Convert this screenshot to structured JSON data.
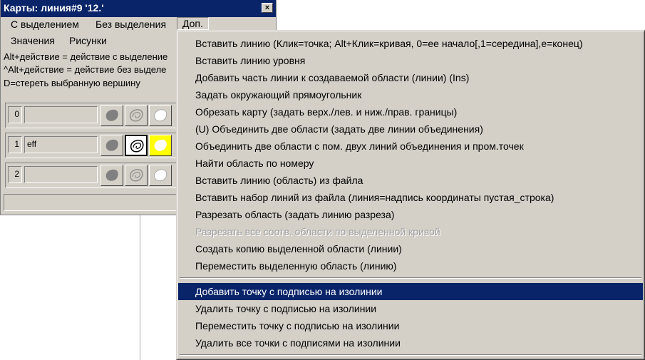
{
  "window": {
    "title": "Карты: линия#9 '12.'",
    "close_label": "×"
  },
  "menubar": {
    "row1": [
      {
        "label": "С выделением"
      },
      {
        "label": "Без выделения"
      },
      {
        "label": "Доп."
      }
    ],
    "row2": [
      {
        "label": "Значения"
      },
      {
        "label": "Рисунки"
      }
    ]
  },
  "hints": [
    "Alt+действие = действие с выделение",
    "^Alt+действие = действие без выделе",
    "D=стереть выбранную вершину"
  ],
  "slots": [
    {
      "number": "0",
      "name": ""
    },
    {
      "number": "1",
      "name": "eff"
    },
    {
      "number": "2",
      "name": ""
    }
  ],
  "popup_menu": {
    "items": [
      {
        "label": "Вставить линию (Клик=точка; Alt+Клик=кривая, 0=ее начало[,1=середина],е=конец)",
        "state": "normal"
      },
      {
        "label": "Вставить линию уровня",
        "state": "normal"
      },
      {
        "label": "Добавить часть линии к создаваемой области (линии) (Ins)",
        "state": "normal"
      },
      {
        "label": "Задать окружающий прямоугольник",
        "state": "normal"
      },
      {
        "label": "Обрезать карту (задать верх./лев. и ниж./прав. границы)",
        "state": "normal"
      },
      {
        "label": "(U) Объединить две области (задать две линии объединения)",
        "state": "normal"
      },
      {
        "label": "Объединить две области с пом. двух линий объединения и пром.точек",
        "state": "normal"
      },
      {
        "label": "Найти область по номеру",
        "state": "normal"
      },
      {
        "label": "Вставить линию (область) из файла",
        "state": "normal"
      },
      {
        "label": "Вставить набор линий из файла (линия=надпись координаты пустая_строка)",
        "state": "normal"
      },
      {
        "label": "Разрезать область (задать линию разреза)",
        "state": "normal"
      },
      {
        "label": "Разрезать все соотв. области по выделенной кривой",
        "state": "disabled"
      },
      {
        "label": "Создать копию выделенной области (линии)",
        "state": "normal"
      },
      {
        "label": "Переместить выделенную область (линию)",
        "state": "normal"
      },
      {
        "label": "Добавить точку  с подписью на изолинии",
        "state": "highlight"
      },
      {
        "label": "Удалить точку  с подписью на изолинии",
        "state": "normal"
      },
      {
        "label": "Переместить точку  с подписью на изолинии",
        "state": "normal"
      },
      {
        "label": "Удалить все точки  с подписями на изолинии",
        "state": "normal"
      }
    ]
  },
  "colors": {
    "title_bar": "#0a246a",
    "highlight": "#0a246a",
    "face": "#d4d0c8",
    "yellow_button": "#ffff00"
  }
}
